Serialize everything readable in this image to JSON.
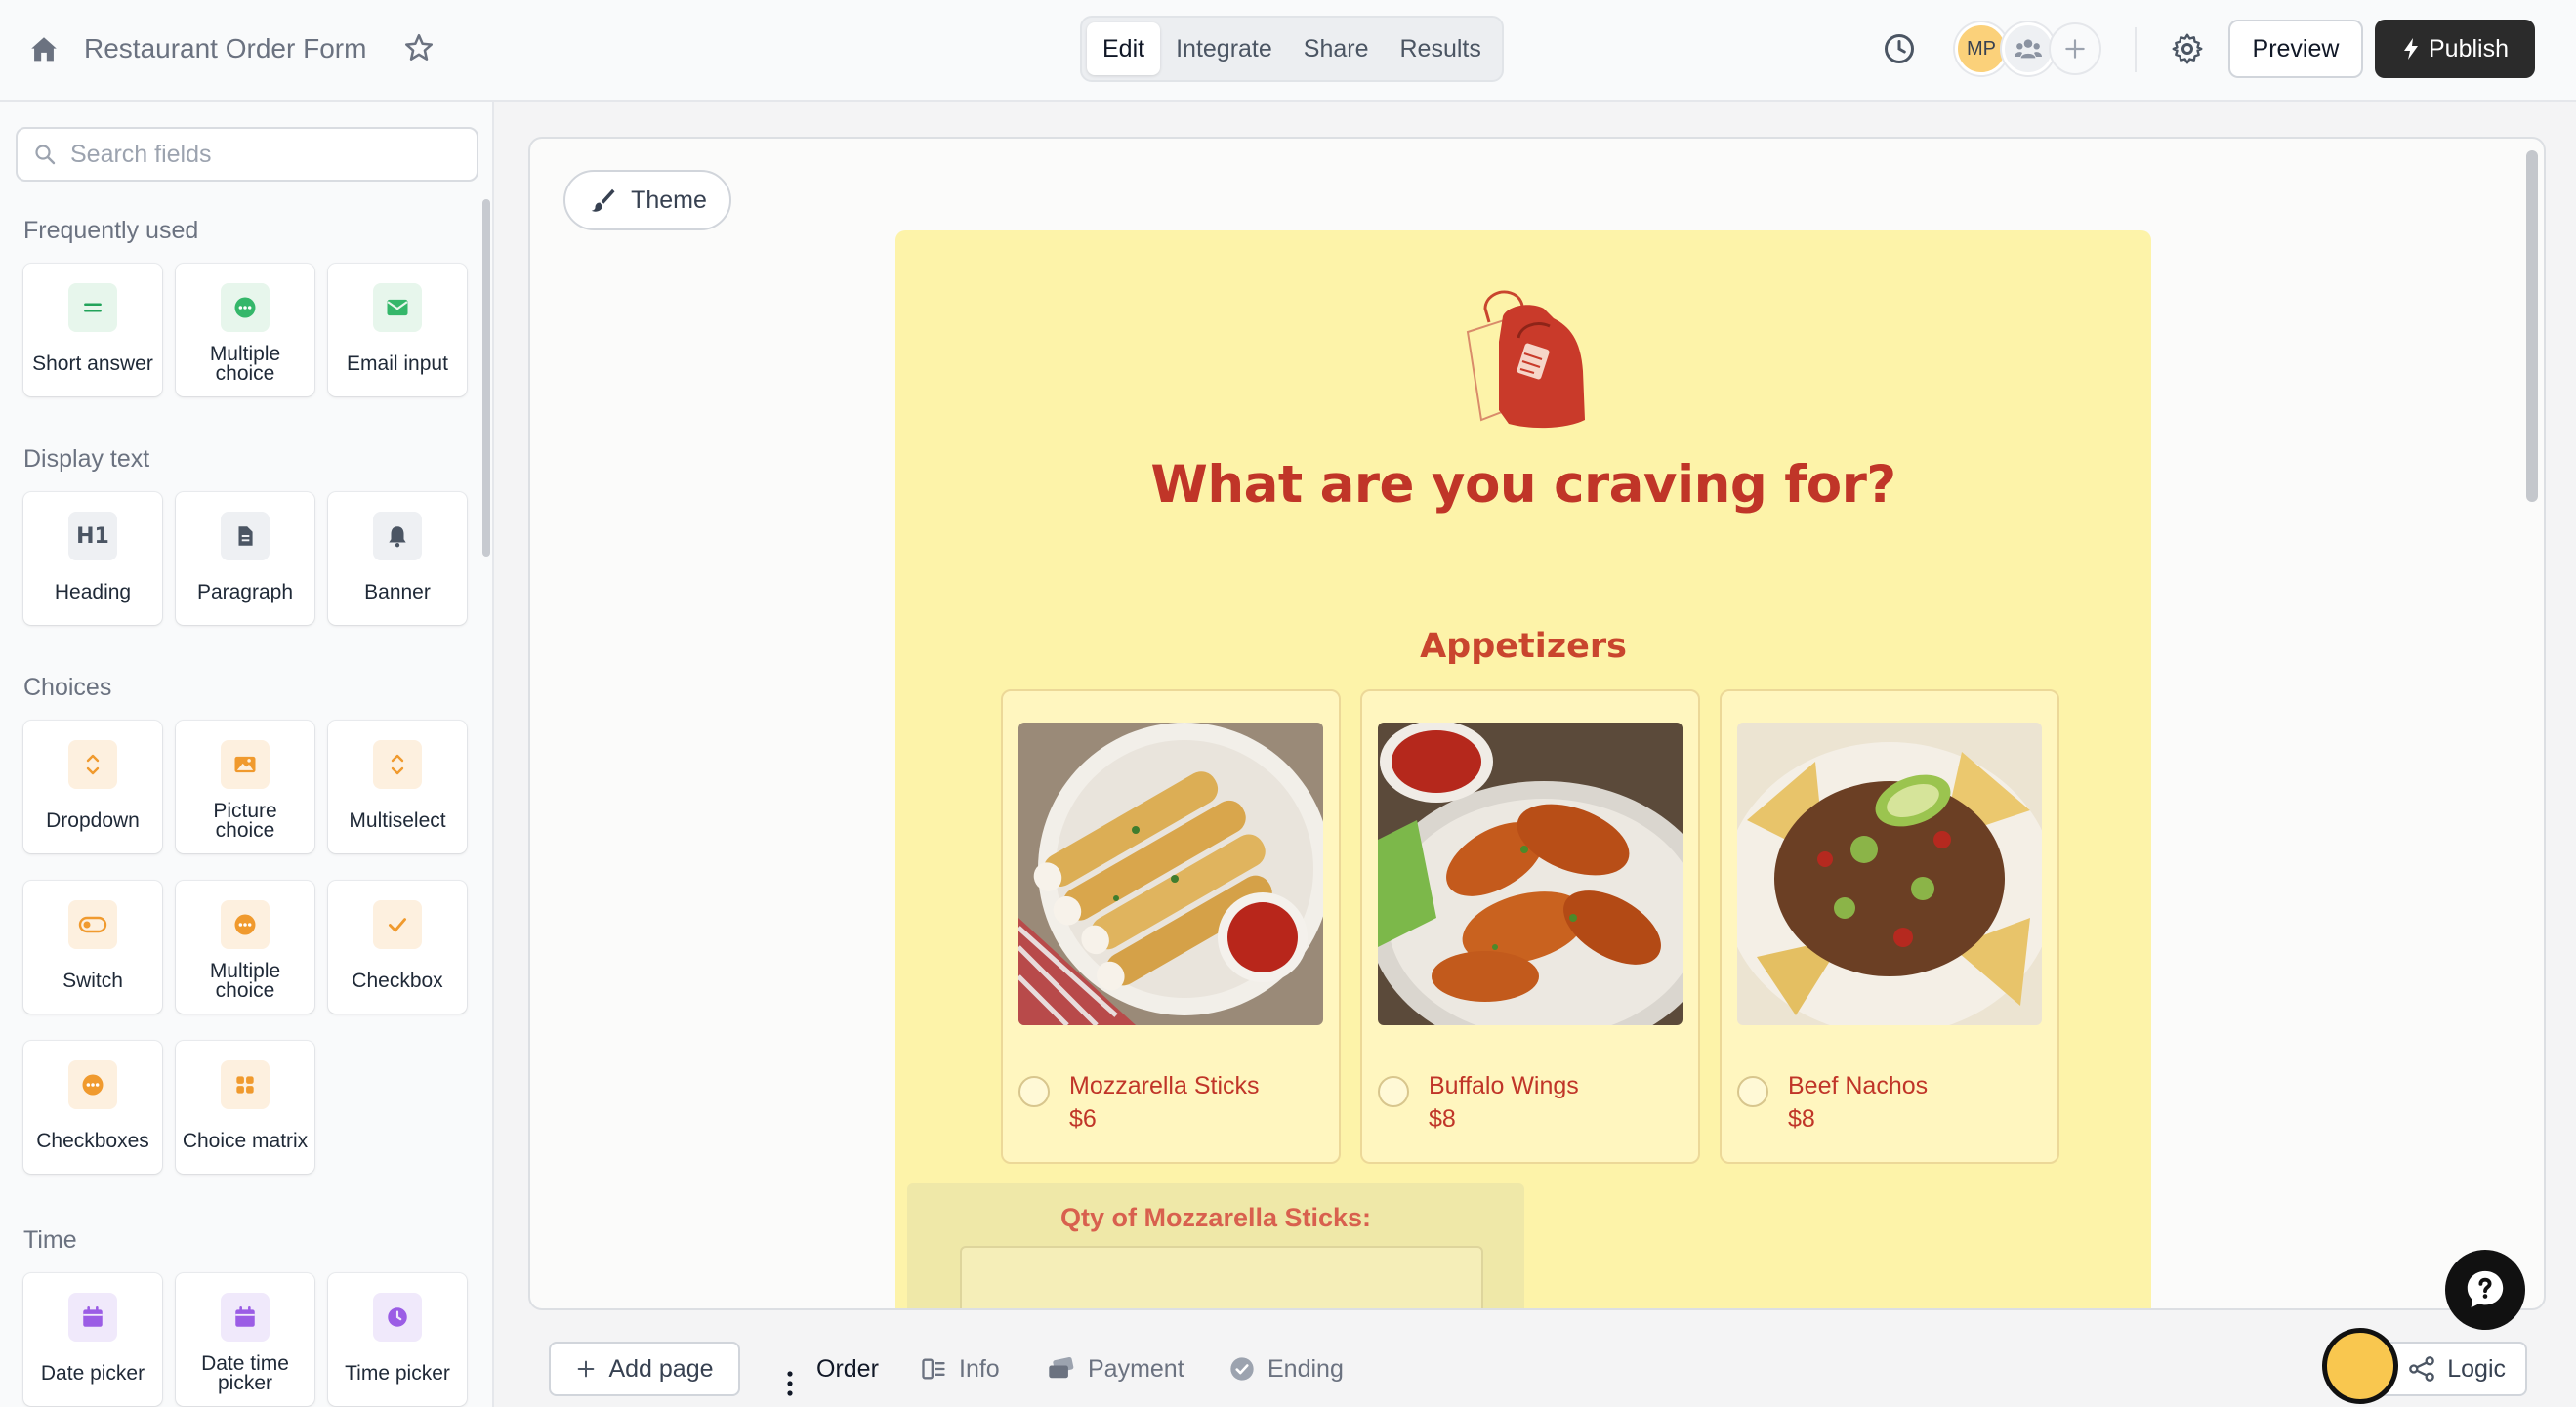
{
  "header": {
    "form_title": "Restaurant Order Form",
    "tabs": [
      {
        "label": "Edit",
        "active": true
      },
      {
        "label": "Integrate",
        "active": false
      },
      {
        "label": "Share",
        "active": false
      },
      {
        "label": "Results",
        "active": false
      }
    ],
    "avatar_initials": "MP",
    "preview_label": "Preview",
    "publish_label": "Publish"
  },
  "sidebar": {
    "search_placeholder": "Search fields",
    "sections": [
      {
        "title": "Frequently used",
        "items": [
          {
            "label": "Short answer",
            "icon": "short-answer-icon",
            "color": "green"
          },
          {
            "label": "Multiple choice",
            "icon": "multiple-choice-icon",
            "color": "green"
          },
          {
            "label": "Email input",
            "icon": "email-icon",
            "color": "green"
          }
        ]
      },
      {
        "title": "Display text",
        "items": [
          {
            "label": "Heading",
            "icon": "heading-icon",
            "color": "gray"
          },
          {
            "label": "Paragraph",
            "icon": "paragraph-icon",
            "color": "gray"
          },
          {
            "label": "Banner",
            "icon": "bell-icon",
            "color": "gray"
          }
        ]
      },
      {
        "title": "Choices",
        "items": [
          {
            "label": "Dropdown",
            "icon": "dropdown-icon",
            "color": "orange"
          },
          {
            "label": "Picture choice",
            "icon": "picture-icon",
            "color": "orange"
          },
          {
            "label": "Multiselect",
            "icon": "multiselect-icon",
            "color": "orange"
          },
          {
            "label": "Switch",
            "icon": "switch-icon",
            "color": "orange"
          },
          {
            "label": "Multiple choice",
            "icon": "multiple-choice-icon",
            "color": "orange"
          },
          {
            "label": "Checkbox",
            "icon": "checkmark-icon",
            "color": "orange"
          },
          {
            "label": "Checkboxes",
            "icon": "checkboxes-icon",
            "color": "orange"
          },
          {
            "label": "Choice matrix",
            "icon": "grid-icon",
            "color": "orange"
          }
        ]
      },
      {
        "title": "Time",
        "items": [
          {
            "label": "Date picker",
            "icon": "calendar-icon",
            "color": "purple"
          },
          {
            "label": "Date time picker",
            "icon": "calendar-icon",
            "color": "purple"
          },
          {
            "label": "Time picker",
            "icon": "clock-icon",
            "color": "purple"
          }
        ]
      }
    ]
  },
  "canvas": {
    "theme_label": "Theme",
    "heading": "What are you craving for?",
    "section_title": "Appetizers",
    "choices": [
      {
        "name": "Mozzarella Sticks",
        "price": "$6",
        "image": "mozzarella-sticks-photo"
      },
      {
        "name": "Buffalo Wings",
        "price": "$8",
        "image": "buffalo-wings-photo"
      },
      {
        "name": "Beef Nachos",
        "price": "$8",
        "image": "beef-nachos-photo"
      }
    ],
    "qty_label": "Qty of Mozzarella Sticks:"
  },
  "bottom": {
    "add_page_label": "Add page",
    "pages": [
      {
        "label": "Order",
        "active": true
      },
      {
        "label": "Info",
        "icon": "info-icon"
      },
      {
        "label": "Payment",
        "icon": "payment-icon"
      },
      {
        "label": "Ending",
        "icon": "check-circle-icon"
      }
    ],
    "logic_label": "Logic"
  },
  "colors": {
    "form_background": "#fdf3a9",
    "form_accent": "#c03528",
    "publish_button": "#2b2b2b"
  }
}
